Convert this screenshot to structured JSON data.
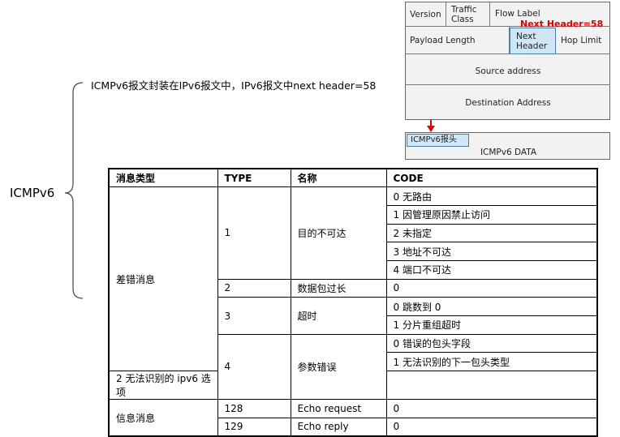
{
  "left_label": "ICMPv6",
  "caption": "ICMPv6报文封装在IPv6报文中，IPv6报文中next header=58",
  "ipv6_header": {
    "version": "Version",
    "traffic_class_line1": "Traffic",
    "traffic_class_line2": "Class",
    "flow_label": "Flow Label",
    "next_header_note": "Next Header=58",
    "payload_length": "Payload Length",
    "next_header_line1": "Next",
    "next_header_line2": "Header",
    "hop_limit": "Hop Limit",
    "source_address": "Source address",
    "destination_address": "Destination Address"
  },
  "icmpv6_packet": {
    "header": "ICMPv6报头",
    "data": "ICMPv6 DATA"
  },
  "table": {
    "headers": [
      "消息类型",
      "TYPE",
      "名称",
      "CODE"
    ],
    "error_group": "差错消息",
    "info_group": "信息消息",
    "rows": [
      {
        "type": "1",
        "name": "目的不可达",
        "codes": [
          "0  无路由",
          "1  因管理原因禁止访问",
          "2  未指定",
          "3  地址不可达",
          "4  端口不可达"
        ]
      },
      {
        "type": "2",
        "name": "数据包过长",
        "codes": [
          "0"
        ]
      },
      {
        "type": "3",
        "name": "超时",
        "codes": [
          "0  跳数到 0",
          "1  分片重组超时"
        ]
      },
      {
        "type": "4",
        "name": "参数错误",
        "codes": [
          "0  错误的包头字段",
          "1  无法识别的下一包头类型",
          "2  无法识别的 ipv6 选项"
        ]
      },
      {
        "type": "128",
        "name": "Echo request",
        "codes": [
          "0"
        ]
      },
      {
        "type": "129",
        "name": "Echo reply",
        "codes": [
          "0"
        ]
      }
    ]
  },
  "colors": {
    "arrow": "#e00000",
    "highlight": "#cfe7f5"
  }
}
